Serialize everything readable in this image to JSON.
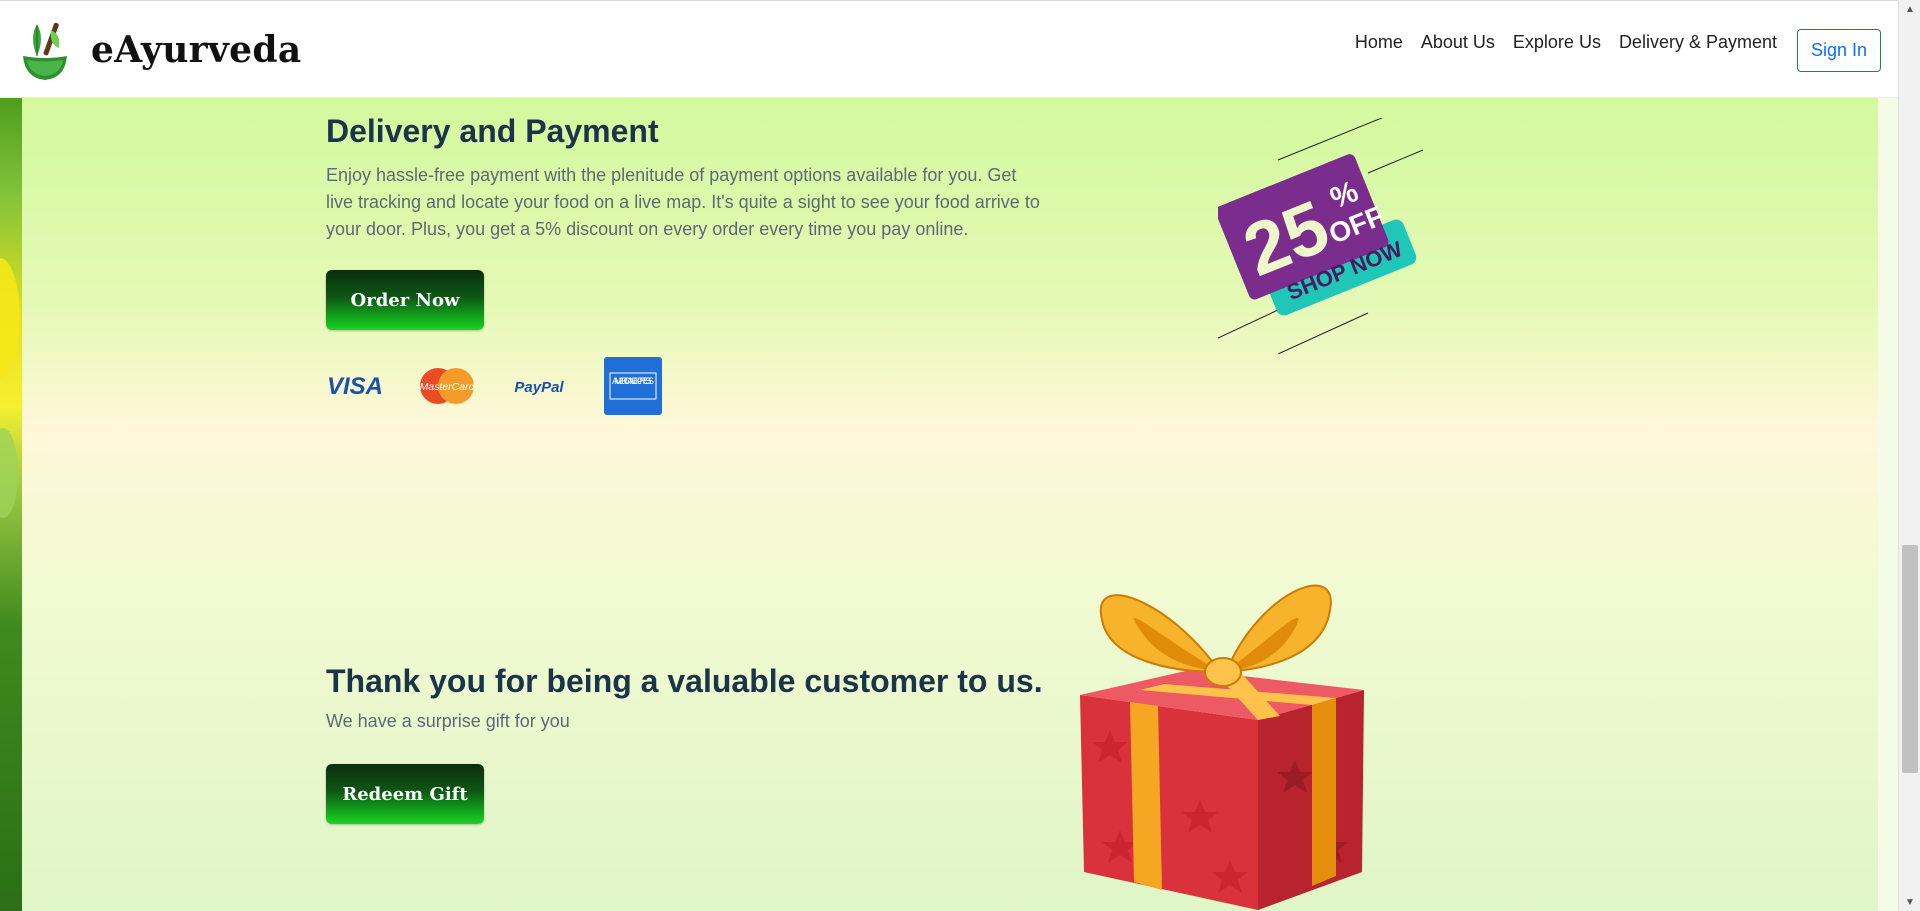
{
  "brand": {
    "name": "eAyurveda"
  },
  "nav": {
    "links": [
      "Home",
      "About Us",
      "Explore Us",
      "Delivery & Payment"
    ],
    "signin_label": "Sign In"
  },
  "delivery": {
    "title": "Delivery and Payment",
    "description": "Enjoy hassle-free payment with the plenitude of payment options available for you. Get live tracking and locate your food on a live map. It's quite a sight to see your food arrive to your door. Plus, you get a 5% discount on every order every time you pay online.",
    "button_label": "Order Now",
    "payment_methods": [
      "VISA",
      "MasterCard",
      "PayPal",
      "AMERICAN EXPRESS"
    ]
  },
  "promo": {
    "percent": "25",
    "percent_sign": "%",
    "off_label": "OFF",
    "shop_label": "SHOP NOW"
  },
  "gift": {
    "title": "Thank you for being a valuable customer to us.",
    "subtitle": "We have a surprise gift for you",
    "button_label": "Redeem Gift"
  },
  "colors": {
    "accent_green": "#13b31c",
    "heading": "#1b3449",
    "body_text": "#5b6a77",
    "promo_purple": "#7b2d8e",
    "promo_teal": "#1fc7b9"
  },
  "icons": {
    "logo": "mortar-pestle-leaf-icon",
    "scroll_up": "triangle-up-icon",
    "scroll_down": "triangle-down-icon"
  }
}
